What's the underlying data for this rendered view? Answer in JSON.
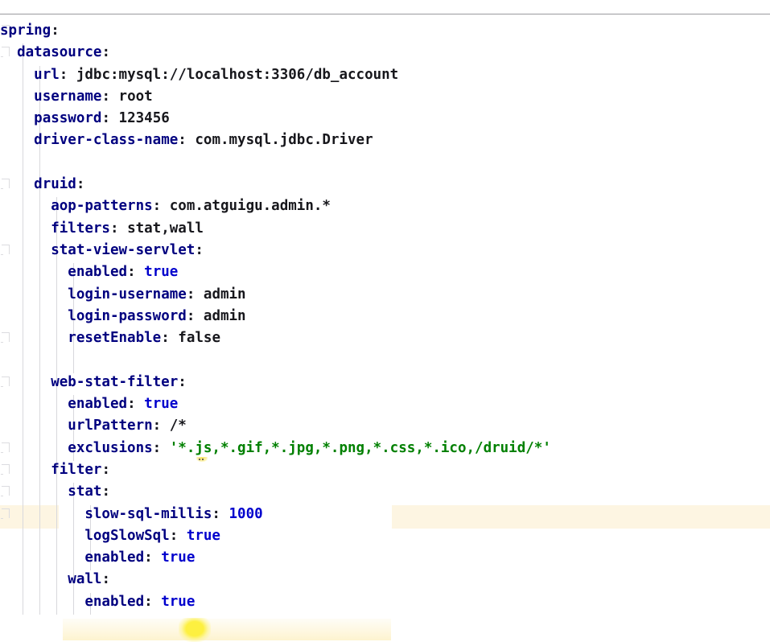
{
  "editor": {
    "language": "yaml",
    "filename_context": "spring datasource druid configuration",
    "colors": {
      "background": "#ffffff",
      "key": "#00007f",
      "value": "#17171c",
      "string": "#008000",
      "literal": "#0000cd",
      "indent_guide": "#d8d8dc",
      "fold_marker": "#dcdce0",
      "highlight_band": "#fdf5e2",
      "glow": "#fdf040",
      "top_rule": "#9a9a9e"
    },
    "lines": [
      {
        "n": 1,
        "indent": 0,
        "fold": true,
        "key": "spring",
        "colon": ":",
        "value": "",
        "value_type": "none"
      },
      {
        "n": 2,
        "indent": 1,
        "fold": true,
        "key": "datasource",
        "colon": ":",
        "value": "",
        "value_type": "none"
      },
      {
        "n": 3,
        "indent": 2,
        "fold": false,
        "key": "url",
        "colon": ":",
        "value": "jdbc:mysql://localhost:3306/db_account",
        "value_type": "plain"
      },
      {
        "n": 4,
        "indent": 2,
        "fold": false,
        "key": "username",
        "colon": ":",
        "value": "root",
        "value_type": "plain"
      },
      {
        "n": 5,
        "indent": 2,
        "fold": false,
        "key": "password",
        "colon": ":",
        "value": "123456",
        "value_type": "plain"
      },
      {
        "n": 6,
        "indent": 2,
        "fold": false,
        "key": "driver-class-name",
        "colon": ":",
        "value": "com.mysql.jdbc.Driver",
        "value_type": "plain"
      },
      {
        "n": 7,
        "indent": 0,
        "fold": false,
        "key": "",
        "colon": "",
        "value": "",
        "value_type": "blank"
      },
      {
        "n": 8,
        "indent": 2,
        "fold": true,
        "key": "druid",
        "colon": ":",
        "value": "",
        "value_type": "none"
      },
      {
        "n": 9,
        "indent": 3,
        "fold": false,
        "key": "aop-patterns",
        "colon": ":",
        "value": "com.atguigu.admin.*",
        "value_type": "plain"
      },
      {
        "n": 10,
        "indent": 3,
        "fold": false,
        "key": "filters",
        "colon": ":",
        "value": "stat,wall",
        "value_type": "plain"
      },
      {
        "n": 11,
        "indent": 3,
        "fold": true,
        "key": "stat-view-servlet",
        "colon": ":",
        "value": "",
        "value_type": "none"
      },
      {
        "n": 12,
        "indent": 4,
        "fold": false,
        "key": "enabled",
        "colon": ":",
        "value": "true",
        "value_type": "literal"
      },
      {
        "n": 13,
        "indent": 4,
        "fold": false,
        "key": "login-username",
        "colon": ":",
        "value": "admin",
        "value_type": "plain"
      },
      {
        "n": 14,
        "indent": 4,
        "fold": false,
        "key": "login-password",
        "colon": ":",
        "value": "admin",
        "value_type": "plain"
      },
      {
        "n": 15,
        "indent": 4,
        "fold": true,
        "key": "resetEnable",
        "colon": ":",
        "value": "false",
        "value_type": "plain"
      },
      {
        "n": 16,
        "indent": 0,
        "fold": false,
        "key": "",
        "colon": "",
        "value": "",
        "value_type": "blank"
      },
      {
        "n": 17,
        "indent": 3,
        "fold": true,
        "key": "web-stat-filter",
        "colon": ":",
        "value": "",
        "value_type": "none"
      },
      {
        "n": 18,
        "indent": 4,
        "fold": false,
        "key": "enabled",
        "colon": ":",
        "value": "true",
        "value_type": "literal"
      },
      {
        "n": 19,
        "indent": 4,
        "fold": false,
        "key": "urlPattern",
        "colon": ":",
        "value": "/*",
        "value_type": "plain"
      },
      {
        "n": 20,
        "indent": 4,
        "fold": true,
        "key": "exclusions",
        "colon": ":",
        "value": "'*.js,*.gif,*.jpg,*.png,*.css,*.ico,/druid/*'",
        "value_type": "string"
      },
      {
        "n": 21,
        "indent": 3,
        "fold": true,
        "key": "filter",
        "colon": ":",
        "value": "",
        "value_type": "none"
      },
      {
        "n": 22,
        "indent": 4,
        "fold": true,
        "key": "stat",
        "colon": ":",
        "value": "",
        "value_type": "none"
      },
      {
        "n": 23,
        "indent": 5,
        "fold": true,
        "key": "slow-sql-millis",
        "colon": ":",
        "value": "1000",
        "value_type": "literal"
      },
      {
        "n": 24,
        "indent": 5,
        "fold": false,
        "key": "logSlowSql",
        "colon": ":",
        "value": "true",
        "value_type": "literal"
      },
      {
        "n": 25,
        "indent": 5,
        "fold": false,
        "key": "enabled",
        "colon": ":",
        "value": "true",
        "value_type": "literal"
      },
      {
        "n": 26,
        "indent": 4,
        "fold": false,
        "key": "wall",
        "colon": ":",
        "value": "",
        "value_type": "none"
      },
      {
        "n": 27,
        "indent": 5,
        "fold": false,
        "key": "enabled",
        "colon": ":",
        "value": "true",
        "value_type": "literal"
      }
    ]
  }
}
